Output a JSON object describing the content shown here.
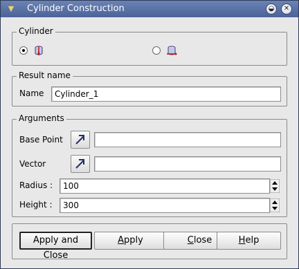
{
  "window": {
    "title": "Cylinder Construction",
    "minimize_label": "◒",
    "close_label": "✕"
  },
  "cylinder_group": {
    "legend": "Cylinder",
    "option1_icon": "cylinder-base-point-vector-icon",
    "option2_icon": "cylinder-plane-icon",
    "selected": 1
  },
  "result_group": {
    "legend": "Result name",
    "name_label": "Name",
    "name_value": "Cylinder_1"
  },
  "arguments_group": {
    "legend": "Arguments",
    "base_point_label": "Base Point",
    "base_point_value": "",
    "vector_label": "Vector",
    "vector_value": "",
    "radius_label": "Radius :",
    "radius_value": "100",
    "height_label": "Height :",
    "height_value": "300"
  },
  "buttons": {
    "apply_close": "Apply and Close",
    "apply_key": "A",
    "apply_rest": "pply",
    "close_key": "C",
    "close_rest": "lose",
    "help_key": "H",
    "help_rest": "elp"
  }
}
